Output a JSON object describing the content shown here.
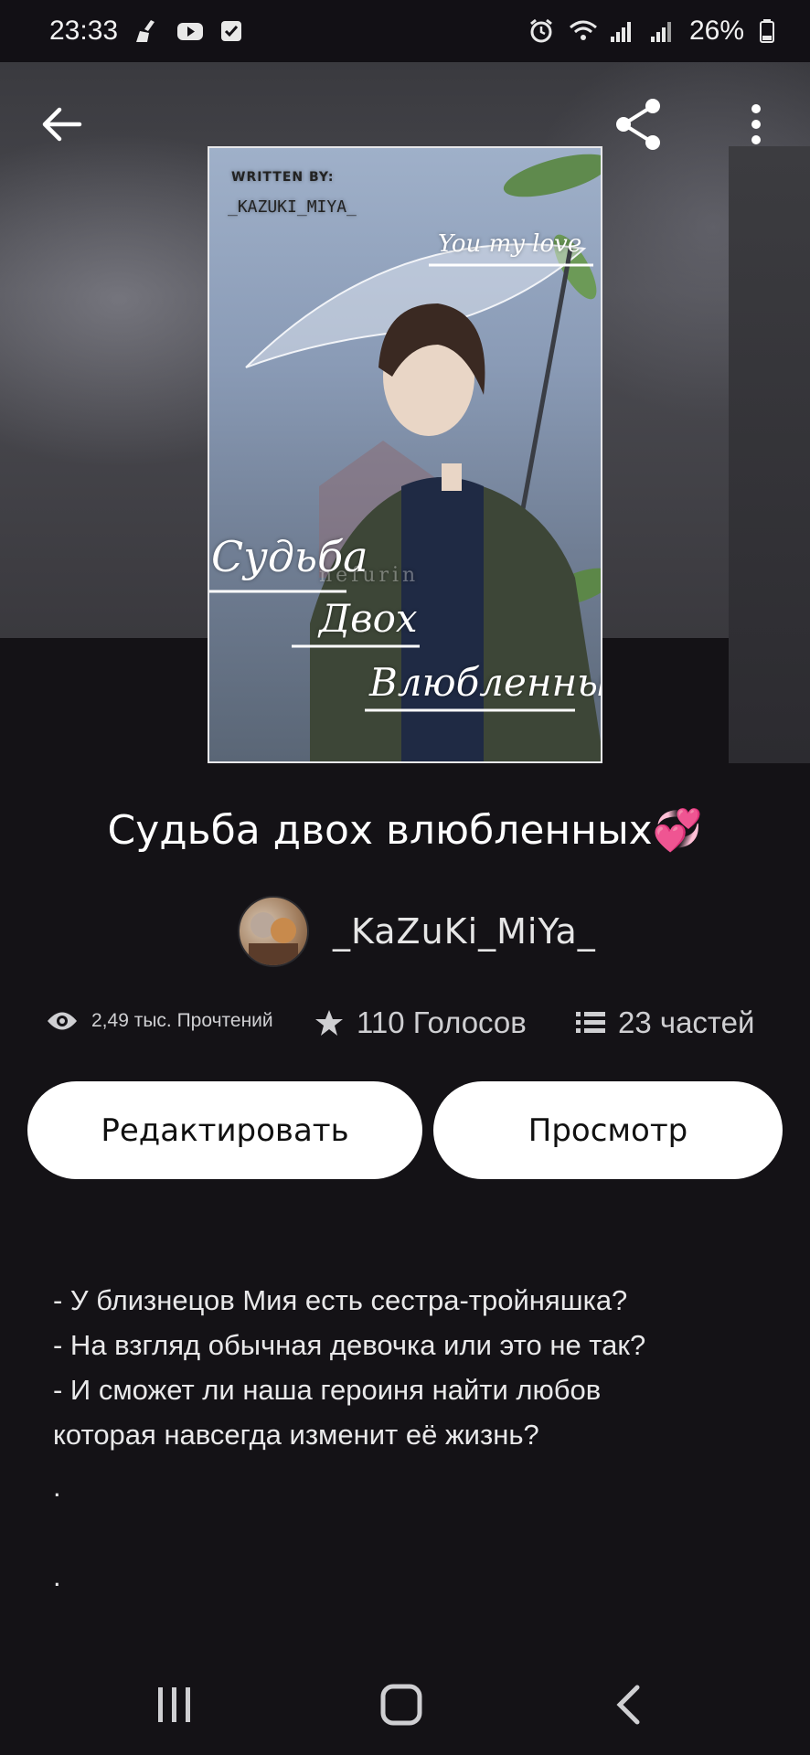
{
  "status_bar": {
    "time": "23:33",
    "left_icons": [
      "broom-icon",
      "youtube-icon",
      "checkbox-icon"
    ],
    "right_icons": [
      "alarm-icon",
      "wifi-icon",
      "signal-icon",
      "signal-icon"
    ],
    "battery": "26%"
  },
  "cover": {
    "written_by": "WRITTEN BY:",
    "author": "_KAZUKI_MIYA_",
    "tagline": "You my love",
    "title_line1": "Судьба",
    "title_line2": "Двох",
    "title_line3": "Влюбленных",
    "watermark": "nefurin"
  },
  "story": {
    "title": "Судьба двох влюбленных💞",
    "author": "_KaZuKi_MiYa_",
    "reads": "2,49 тыс. Прочтений",
    "votes": "110 Голосов",
    "parts": "23 частей"
  },
  "buttons": {
    "edit": "Редактировать",
    "view": "Просмотр"
  },
  "description": {
    "lines": [
      "- У близнецов Мия есть сестра-тройняшка?",
      "- На взгляд обычная девочка или это не так?",
      "- И сможет ли наша героиня найти любов",
      "которая навсегда изменит её жизнь?",
      ".",
      "",
      "."
    ]
  }
}
